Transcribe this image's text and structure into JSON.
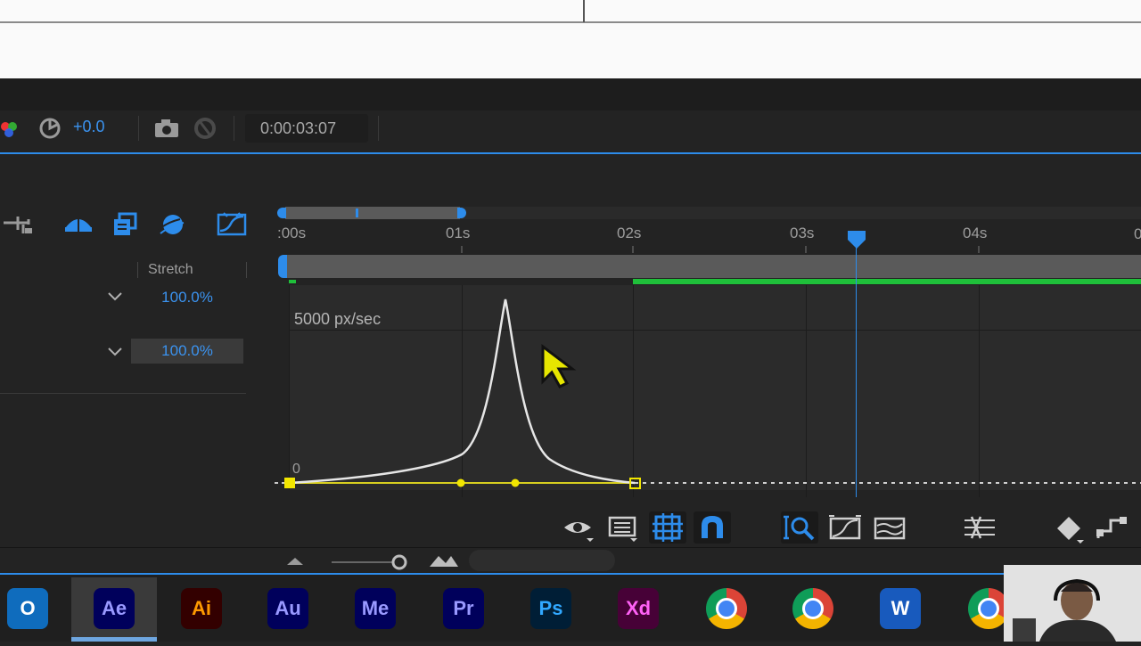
{
  "viewer": {
    "exposure": "+0.0",
    "timecode": "0:00:03:07"
  },
  "timeline": {
    "column_header": "Stretch",
    "stretch_values": [
      "100.0%",
      "100.0%"
    ],
    "ruler_labels": [
      ":00s",
      "01s",
      "02s",
      "03s",
      "04s"
    ],
    "graph_top_label": "5000 px/sec",
    "graph_zero_label": "0"
  },
  "taskbar": {
    "apps": [
      {
        "name": "Outlook",
        "label": "O",
        "color": "#0f6cbd"
      },
      {
        "name": "After Effects",
        "label": "Ae",
        "color": "#00005b",
        "text_color": "#9999ff",
        "active": true
      },
      {
        "name": "Illustrator",
        "label": "Ai",
        "color": "#330000",
        "text_color": "#ff9a00"
      },
      {
        "name": "Audition",
        "label": "Au",
        "color": "#00005b",
        "text_color": "#9999ff"
      },
      {
        "name": "Media Encoder",
        "label": "Me",
        "color": "#00005b",
        "text_color": "#9999ff"
      },
      {
        "name": "Premiere Pro",
        "label": "Pr",
        "color": "#00005b",
        "text_color": "#9999ff"
      },
      {
        "name": "Photoshop",
        "label": "Ps",
        "color": "#001e36",
        "text_color": "#31a8ff"
      },
      {
        "name": "XD",
        "label": "Xd",
        "color": "#470137",
        "text_color": "#ff61f6"
      },
      {
        "name": "Chrome",
        "label": "",
        "color": "#db4437"
      },
      {
        "name": "Chrome",
        "label": "",
        "color": "#db4437"
      },
      {
        "name": "Word",
        "label": "W",
        "color": "#185abd"
      },
      {
        "name": "Chrome",
        "label": "",
        "color": "#db4437"
      }
    ]
  },
  "colors": {
    "accent_blue": "#2d8ceb",
    "keyframe_yellow": "#f2e600",
    "work_area_green": "#1fbf3a",
    "curve_white": "#e6e6e6"
  },
  "icons": [
    "color-channels-icon",
    "exposure-reset-icon",
    "snapshot-camera-icon",
    "show-snapshot-icon",
    "comp-flowchart-icon",
    "draft-3d-icon",
    "frame-blending-icon",
    "motion-blur-icon",
    "graph-editor-icon",
    "playhead-icon",
    "eye-icon",
    "graph-type-icon",
    "transform-box-icon",
    "snap-magnet-icon",
    "fit-selection-icon",
    "fit-all-icon",
    "graph-view-icon",
    "separate-dimensions-icon",
    "keyframe-icon",
    "easy-ease-icon",
    "zoom-out-icon",
    "zoom-slider-icon",
    "zoom-in-icon",
    "cursor-arrow-icon"
  ]
}
